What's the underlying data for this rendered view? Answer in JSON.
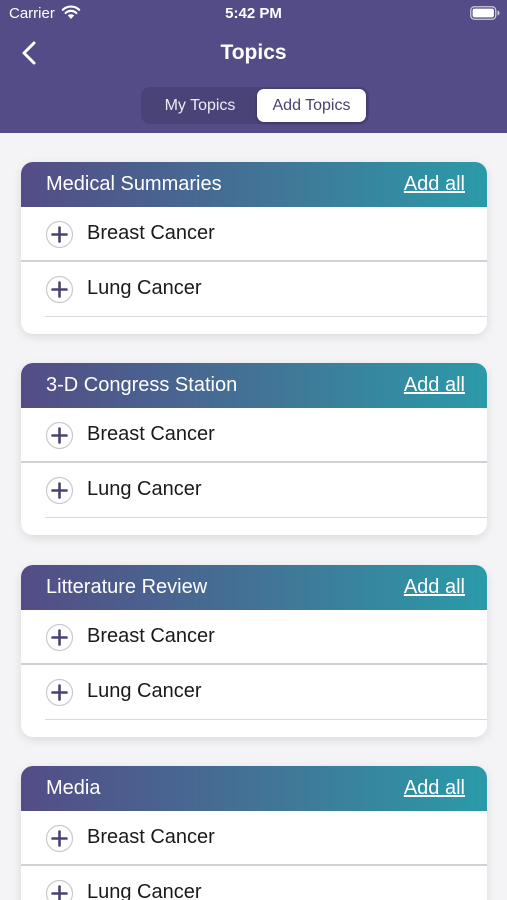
{
  "status_bar": {
    "carrier": "Carrier",
    "time": "5:42 PM"
  },
  "nav": {
    "title": "Topics",
    "back_icon": "chevron-left-icon"
  },
  "segments": [
    {
      "label": "My Topics",
      "selected": false
    },
    {
      "label": "Add Topics",
      "selected": true
    }
  ],
  "colors": {
    "header_bg": "#544c86",
    "gradient_start": "#544c86",
    "gradient_end": "#2a9aa9"
  },
  "sections": [
    {
      "title": "Medical Summaries",
      "add_all": "Add all",
      "items": [
        "Breast Cancer",
        "Lung Cancer"
      ]
    },
    {
      "title": "3-D Congress Station",
      "add_all": "Add all",
      "items": [
        "Breast Cancer",
        "Lung Cancer"
      ]
    },
    {
      "title": "Litterature Review",
      "add_all": "Add all",
      "items": [
        "Breast Cancer",
        "Lung Cancer"
      ]
    },
    {
      "title": "Media",
      "add_all": "Add all",
      "items": [
        "Breast Cancer",
        "Lung Cancer"
      ]
    }
  ]
}
